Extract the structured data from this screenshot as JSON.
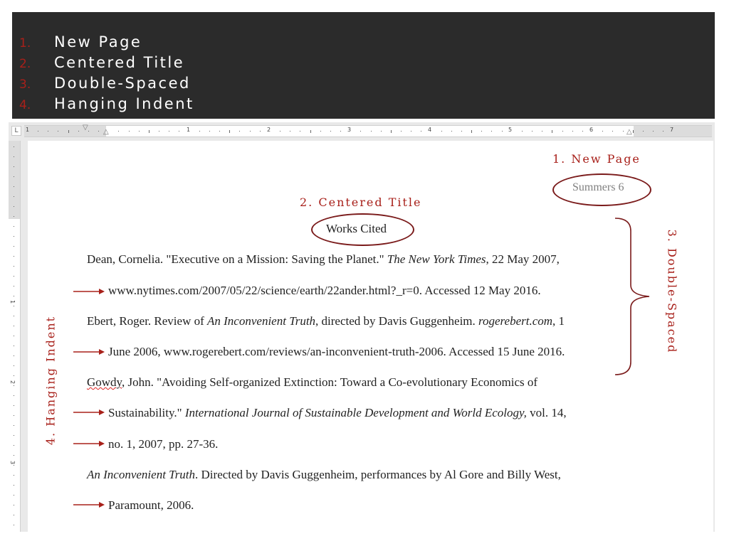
{
  "header": {
    "items": [
      {
        "num": "1.",
        "label": "New Page"
      },
      {
        "num": "2.",
        "label": "Centered Title"
      },
      {
        "num": "3.",
        "label": "Double-Spaced"
      },
      {
        "num": "4.",
        "label": "Hanging Indent"
      }
    ]
  },
  "ruler": {
    "corner": "L",
    "numbers": [
      "1",
      "1",
      "2",
      "3",
      "4",
      "5",
      "6",
      "7"
    ]
  },
  "vruler": {
    "numbers": [
      "1",
      "2",
      "3"
    ]
  },
  "annotations": {
    "new_page": "1. New Page",
    "centered_title": "2. Centered Title",
    "double_spaced": "3. Double-Spaced",
    "hanging_indent": "4. Hanging Indent"
  },
  "document": {
    "running_head": "Summers 6",
    "title": "Works Cited",
    "entries": {
      "l1": {
        "a": "Dean, Cornelia. \"Executive on a Mission: Saving the Planet.\" ",
        "i": "The New York Times",
        "b": ", 22 May 2007,"
      },
      "l2": "www.nytimes.com/2007/05/22/science/earth/22ander.html?_r=0. Accessed 12 May 2016.",
      "l3": {
        "a": "Ebert, Roger. Review of ",
        "i": "An Inconvenient Truth",
        "b": ", directed by Davis Guggenheim. ",
        "i2": "rogerebert.com",
        "c": ", 1"
      },
      "l4": "June 2006, www.rogerebert.com/reviews/an-inconvenient-truth-2006. Accessed 15 June 2016.",
      "l5": {
        "spell": "Gowdy",
        "a": ", John. \"Avoiding Self-organized Extinction: Toward a Co-evolutionary Economics of"
      },
      "l6": {
        "a": "Sustainability.\" ",
        "i": "International Journal of Sustainable Development and World Ecology,",
        "b": " vol. 14,"
      },
      "l7": "no. 1, 2007, pp. 27-36.",
      "l8": {
        "i": "An Inconvenient Truth",
        "a": ". Directed by Davis Guggenheim, performances by Al Gore and Billy West,"
      },
      "l9": "Paramount, 2006."
    }
  },
  "colors": {
    "accent": "#a8201a",
    "header_bg": "#2b2b2b",
    "oval": "#7a1a1a"
  }
}
